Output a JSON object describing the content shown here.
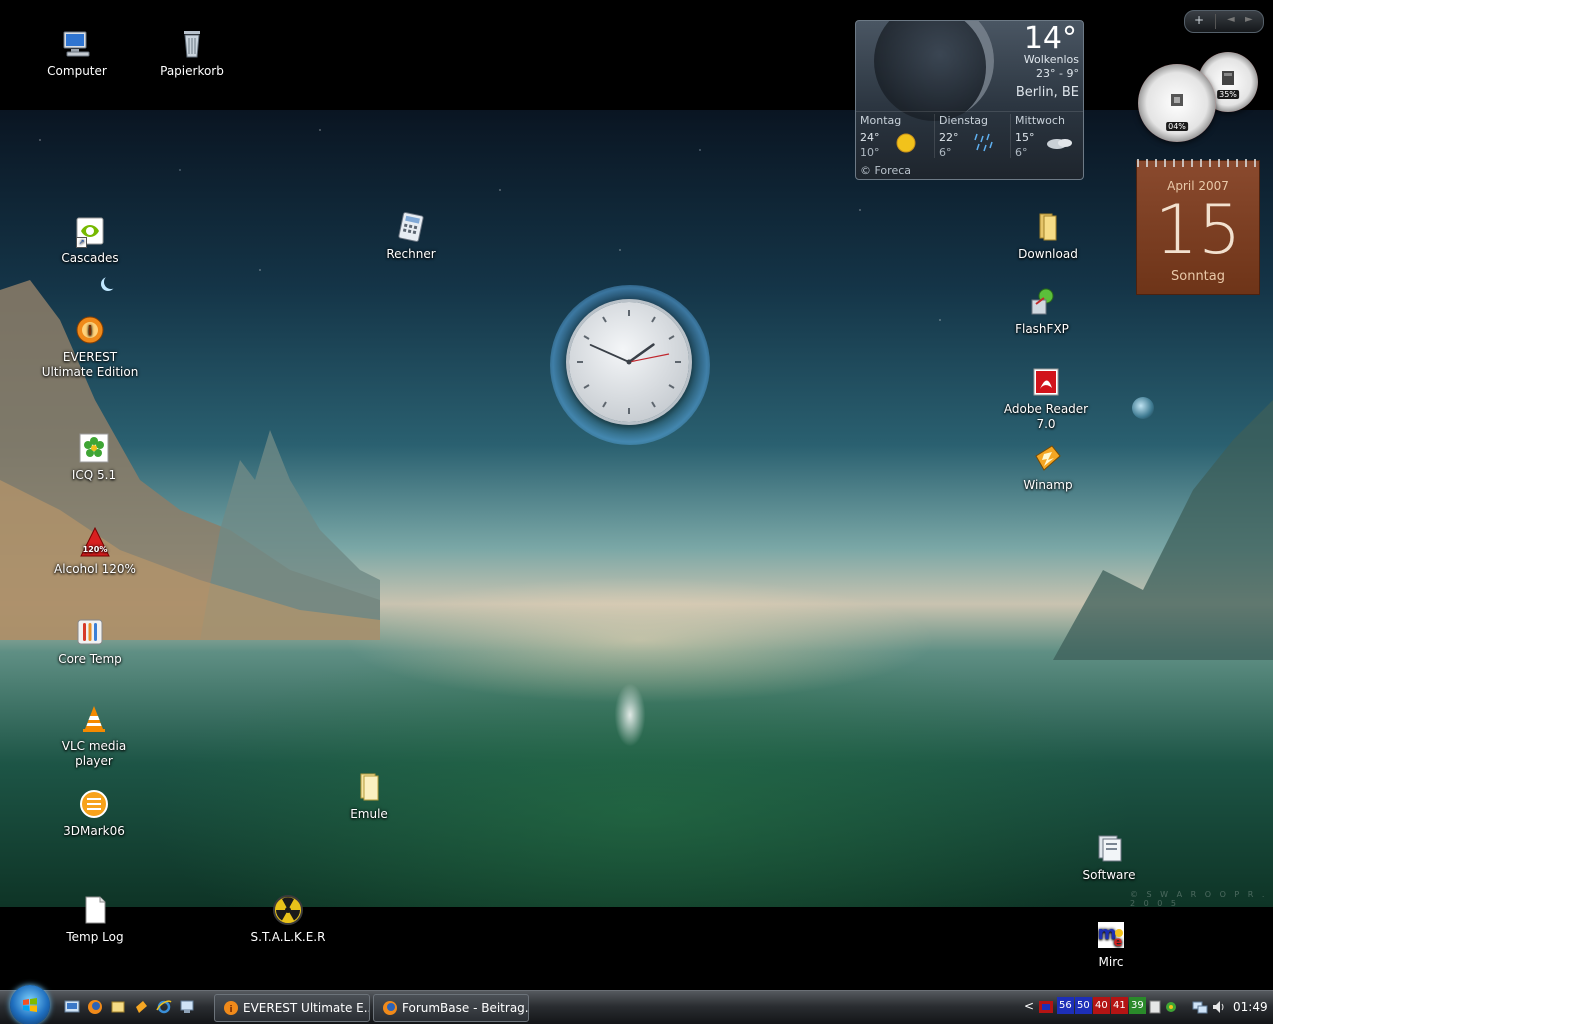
{
  "desktop": {
    "icons": [
      {
        "id": "computer",
        "label": "Computer"
      },
      {
        "id": "papierkorb",
        "label": "Papierkorb"
      },
      {
        "id": "cascades",
        "label": "Cascades"
      },
      {
        "id": "rechner",
        "label": "Rechner"
      },
      {
        "id": "everest",
        "label": "EVEREST Ultimate Edition"
      },
      {
        "id": "icq",
        "label": "ICQ 5.1"
      },
      {
        "id": "alcohol",
        "label": "Alcohol 120%"
      },
      {
        "id": "coretemp",
        "label": "Core Temp"
      },
      {
        "id": "vlc",
        "label": "VLC media player"
      },
      {
        "id": "3dmark",
        "label": "3DMark06"
      },
      {
        "id": "emule",
        "label": "Emule"
      },
      {
        "id": "templog",
        "label": "Temp Log"
      },
      {
        "id": "stalker",
        "label": "S.T.A.L.K.E.R"
      },
      {
        "id": "download",
        "label": "Download"
      },
      {
        "id": "flashfxp",
        "label": "FlashFXP"
      },
      {
        "id": "adobereader",
        "label": "Adobe Reader 7.0"
      },
      {
        "id": "winamp",
        "label": "Winamp"
      },
      {
        "id": "software",
        "label": "Software"
      },
      {
        "id": "mirc",
        "label": "Mirc"
      }
    ],
    "wallpaper_credit": "© S W A R O O P   R .   2 0 0 5"
  },
  "weather": {
    "temp": "14°",
    "condition": "Wolkenlos",
    "range": "23° -  9°",
    "city": "Berlin, BE",
    "days": [
      {
        "name": "Montag",
        "hi": "24°",
        "lo": "10°",
        "icon": "sun-icon"
      },
      {
        "name": "Dienstag",
        "hi": "22°",
        "lo": "6°",
        "icon": "rain-icon"
      },
      {
        "name": "Mittwoch",
        "hi": "15°",
        "lo": "6°",
        "icon": "cloud-icon"
      }
    ],
    "credit": "© Foreca"
  },
  "cpu_meter": {
    "cpu_pct": "04%",
    "ram_pct": "35%"
  },
  "calendar": {
    "month_year": "April 2007",
    "day": "15",
    "weekday": "Sonntag"
  },
  "clock": {
    "hour": 1,
    "minute": 49
  },
  "sidebar": {
    "add": "+",
    "prev": "◄",
    "next": "►"
  },
  "taskbar": {
    "buttons": [
      {
        "label": "EVEREST Ultimate E..."
      },
      {
        "label": "ForumBase - Beitrag..."
      }
    ],
    "tray_values": [
      "56",
      "50",
      "40",
      "41",
      "39"
    ],
    "tray_colors": [
      "#1d2fb8",
      "#1d2fb8",
      "#b41414",
      "#b41414",
      "#2a8a2a"
    ],
    "time": "01:49",
    "chevron": "<"
  },
  "colors": {
    "accent": "#1f6fbf",
    "calendar": "#7a3c20"
  }
}
